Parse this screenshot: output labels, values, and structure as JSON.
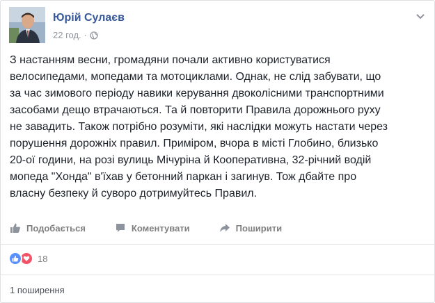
{
  "post": {
    "author_name": "Юрій Сулаєв",
    "timestamp": "22 год.",
    "privacy_separator": "·",
    "privacy_icon": "globe-icon",
    "text_lines": [
      "З настанням весни, громадяни почали активно користуватися",
      "велосипедами, мопедами та мотоциклами. Однак, не слід забувати, що",
      "за час зимового періоду навики керування двоколісними транспортними",
      "засобами дещо втрачаються. Та й повторити Правила дорожнього руху",
      "не завадить. Також потрібно розуміти, які наслідки можуть настати через",
      "порушення дорожніх правил. Приміром, вчора в місті Глобино, близько",
      "20-ої години, на розі вулиць Мічуріна й Кооперативна, 32-річний водій",
      "мопеда \"Хонда\" в'їхав у бетонний паркан і загинув. Тож дбайте про",
      "власну безпеку й суворо дотримуйтесь Правил."
    ]
  },
  "actions": {
    "like_label": "Подобається",
    "comment_label": "Коментувати",
    "share_label": "Поширити"
  },
  "reactions": {
    "count": "18",
    "types": [
      "like",
      "love"
    ],
    "like_color": "#5890ff",
    "love_color": "#f25268"
  },
  "shares": {
    "label": "1 поширення"
  },
  "colors": {
    "author_link": "#365899",
    "meta_text": "#90949c",
    "action_text": "#7f7f7f",
    "body_text": "#1d2129"
  }
}
